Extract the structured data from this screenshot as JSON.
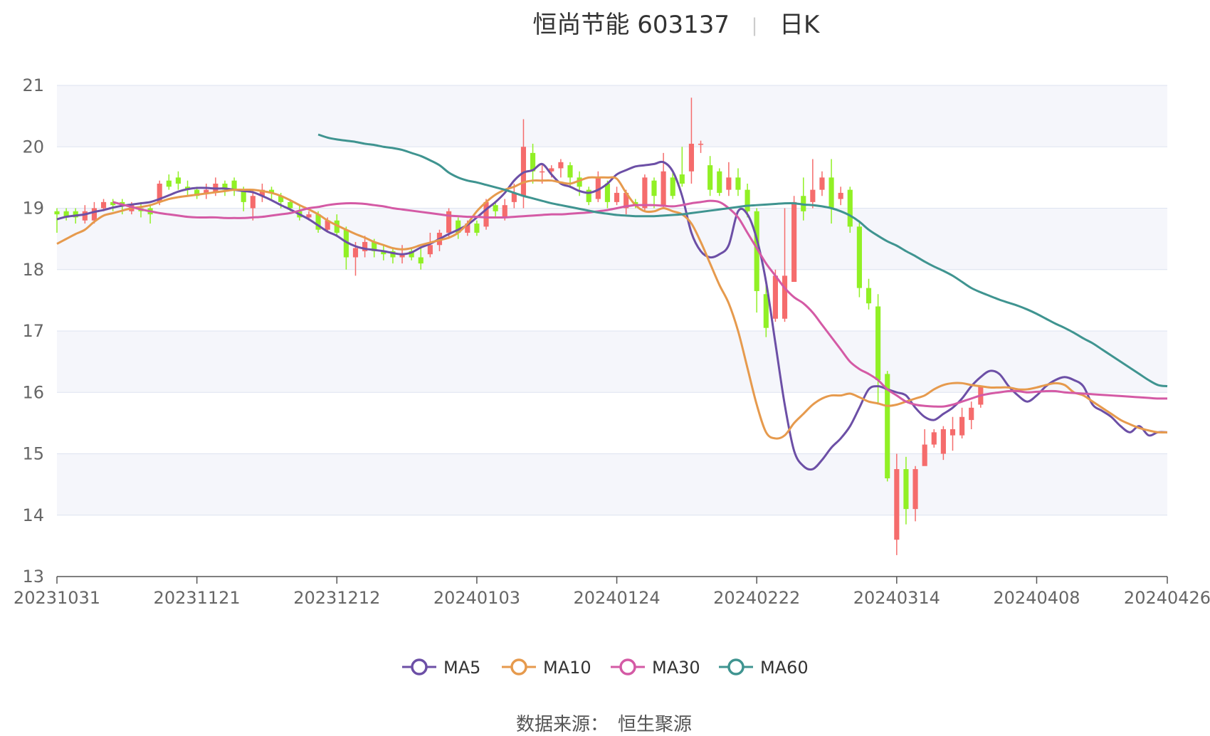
{
  "header": {
    "name_code": "恒尚节能 603137",
    "separator": "|",
    "period": "日K"
  },
  "source": {
    "label": "数据来源：",
    "value": "恒生聚源"
  },
  "colors": {
    "up": "#f56c6c",
    "down": "#91f025",
    "band": "#f5f6fb",
    "grid": "#dde3f0",
    "MA5": "#6c4fa6",
    "MA10": "#e69a4d",
    "MA30": "#d45aa5",
    "MA60": "#3f9490"
  },
  "chart_data": {
    "type": "candlestick",
    "title": "恒尚节能 603137 日K",
    "ylim": [
      13,
      21
    ],
    "yticks": [
      13,
      14,
      15,
      16,
      17,
      18,
      19,
      20,
      21
    ],
    "grid": true,
    "legend_position": "bottom-center",
    "categories": [
      "20231031",
      "20231101",
      "20231102",
      "20231103",
      "20231106",
      "20231107",
      "20231108",
      "20231109",
      "20231110",
      "20231113",
      "20231114",
      "20231115",
      "20231116",
      "20231117",
      "20231120",
      "20231121",
      "20231122",
      "20231123",
      "20231124",
      "20231127",
      "20231128",
      "20231129",
      "20231130",
      "20231201",
      "20231204",
      "20231205",
      "20231206",
      "20231207",
      "20231208",
      "20231211",
      "20231212",
      "20231213",
      "20231214",
      "20231215",
      "20231218",
      "20231219",
      "20231220",
      "20231221",
      "20231222",
      "20231225",
      "20231226",
      "20231227",
      "20231228",
      "20231229",
      "20240102",
      "20240103",
      "20240104",
      "20240105",
      "20240108",
      "20240109",
      "20240110",
      "20240111",
      "20240112",
      "20240115",
      "20240116",
      "20240117",
      "20240118",
      "20240119",
      "20240122",
      "20240123",
      "20240124",
      "20240125",
      "20240126",
      "20240129",
      "20240130",
      "20240131",
      "20240201",
      "20240202",
      "20240205",
      "20240206",
      "20240207",
      "20240208",
      "20240219",
      "20240220",
      "20240221",
      "20240222",
      "20240223",
      "20240226",
      "20240227",
      "20240228",
      "20240229",
      "20240301",
      "20240304",
      "20240305",
      "20240306",
      "20240307",
      "20240308",
      "20240311",
      "20240312",
      "20240313",
      "20240314",
      "20240315",
      "20240318",
      "20240319",
      "20240320",
      "20240321",
      "20240322",
      "20240325",
      "20240326",
      "20240327",
      "20240328",
      "20240329",
      "20240401",
      "20240402",
      "20240403",
      "20240408",
      "20240409",
      "20240410",
      "20240411",
      "20240412",
      "20240415",
      "20240416",
      "20240417",
      "20240418",
      "20240419",
      "20240422",
      "20240423",
      "20240424",
      "20240425",
      "20240426"
    ],
    "xtick_labels": [
      "20231031",
      "20231121",
      "20231212",
      "20240103",
      "20240124",
      "20240222",
      "20240314",
      "20240408",
      "20240426"
    ],
    "xtick_indices": [
      0,
      15,
      30,
      45,
      60,
      75,
      90,
      105,
      119
    ],
    "ohlc": [
      [
        18.95,
        18.9,
        18.6,
        19.0
      ],
      [
        18.95,
        18.85,
        18.8,
        19.0
      ],
      [
        18.95,
        18.85,
        18.75,
        19.0
      ],
      [
        18.8,
        18.95,
        18.75,
        19.05
      ],
      [
        18.8,
        19.0,
        18.75,
        19.1
      ],
      [
        19.0,
        19.1,
        18.95,
        19.15
      ],
      [
        19.1,
        19.05,
        18.95,
        19.15
      ],
      [
        19.1,
        19.05,
        18.9,
        19.15
      ],
      [
        18.95,
        19.05,
        18.9,
        19.1
      ],
      [
        19.0,
        18.95,
        18.85,
        19.1
      ],
      [
        19.0,
        18.9,
        18.75,
        19.05
      ],
      [
        19.1,
        19.4,
        19.05,
        19.45
      ],
      [
        19.45,
        19.35,
        19.3,
        19.55
      ],
      [
        19.5,
        19.4,
        19.3,
        19.6
      ],
      [
        19.35,
        19.3,
        19.2,
        19.45
      ],
      [
        19.3,
        19.2,
        19.15,
        19.35
      ],
      [
        19.25,
        19.3,
        19.15,
        19.4
      ],
      [
        19.25,
        19.4,
        19.2,
        19.5
      ],
      [
        19.4,
        19.3,
        19.2,
        19.45
      ],
      [
        19.45,
        19.3,
        19.2,
        19.5
      ],
      [
        19.3,
        19.1,
        18.95,
        19.35
      ],
      [
        19.0,
        19.2,
        18.8,
        19.3
      ],
      [
        19.2,
        19.3,
        19.1,
        19.4
      ],
      [
        19.3,
        19.25,
        19.15,
        19.35
      ],
      [
        19.2,
        19.1,
        19.0,
        19.25
      ],
      [
        19.1,
        19.0,
        18.95,
        19.15
      ],
      [
        18.95,
        18.85,
        18.8,
        19.05
      ],
      [
        18.85,
        18.9,
        18.8,
        18.95
      ],
      [
        18.9,
        18.65,
        18.6,
        18.95
      ],
      [
        18.65,
        18.8,
        18.6,
        18.85
      ],
      [
        18.8,
        18.6,
        18.55,
        18.9
      ],
      [
        18.65,
        18.2,
        18.0,
        18.7
      ],
      [
        18.2,
        18.35,
        17.9,
        18.45
      ],
      [
        18.3,
        18.45,
        18.2,
        18.55
      ],
      [
        18.45,
        18.3,
        18.2,
        18.5
      ],
      [
        18.3,
        18.25,
        18.15,
        18.4
      ],
      [
        18.3,
        18.2,
        18.1,
        18.35
      ],
      [
        18.2,
        18.25,
        18.1,
        18.4
      ],
      [
        18.3,
        18.2,
        18.15,
        18.35
      ],
      [
        18.2,
        18.1,
        18.0,
        18.35
      ],
      [
        18.25,
        18.4,
        18.2,
        18.6
      ],
      [
        18.4,
        18.6,
        18.3,
        18.65
      ],
      [
        18.6,
        18.95,
        18.5,
        19.0
      ],
      [
        18.8,
        18.6,
        18.5,
        18.85
      ],
      [
        18.6,
        18.75,
        18.55,
        18.8
      ],
      [
        18.75,
        18.6,
        18.55,
        18.8
      ],
      [
        18.7,
        19.1,
        18.65,
        19.15
      ],
      [
        19.05,
        18.95,
        18.85,
        19.1
      ],
      [
        18.85,
        19.05,
        18.8,
        19.15
      ],
      [
        19.1,
        19.25,
        19.0,
        19.4
      ],
      [
        19.2,
        20.0,
        19.0,
        20.45
      ],
      [
        19.9,
        19.6,
        19.4,
        20.05
      ],
      [
        19.6,
        19.6,
        19.4,
        19.7
      ],
      [
        19.6,
        19.65,
        19.5,
        19.7
      ],
      [
        19.65,
        19.75,
        19.5,
        19.8
      ],
      [
        19.7,
        19.5,
        19.35,
        19.75
      ],
      [
        19.5,
        19.35,
        19.2,
        19.6
      ],
      [
        19.3,
        19.1,
        19.05,
        19.35
      ],
      [
        19.15,
        19.5,
        19.1,
        19.6
      ],
      [
        19.4,
        19.1,
        19.0,
        19.45
      ],
      [
        19.1,
        19.25,
        19.05,
        19.35
      ],
      [
        19.0,
        19.25,
        18.9,
        19.3
      ],
      [
        19.1,
        19.05,
        19.0,
        19.15
      ],
      [
        19.0,
        19.5,
        18.95,
        19.55
      ],
      [
        19.45,
        19.2,
        19.0,
        19.5
      ],
      [
        19.05,
        19.6,
        19.0,
        19.9
      ],
      [
        19.5,
        19.2,
        19.15,
        19.6
      ],
      [
        19.55,
        19.4,
        19.35,
        20.0
      ],
      [
        19.6,
        20.05,
        19.4,
        20.8
      ],
      [
        20.05,
        20.05,
        19.9,
        20.1
      ],
      [
        19.7,
        19.3,
        19.2,
        19.85
      ],
      [
        19.6,
        19.25,
        19.2,
        19.65
      ],
      [
        19.3,
        19.5,
        19.2,
        19.75
      ],
      [
        19.5,
        19.3,
        19.2,
        19.65
      ],
      [
        19.3,
        18.95,
        18.85,
        19.4
      ],
      [
        18.95,
        17.65,
        17.3,
        19.0
      ],
      [
        17.6,
        17.05,
        16.9,
        17.75
      ],
      [
        17.2,
        17.9,
        17.15,
        18.0
      ],
      [
        17.2,
        17.9,
        17.15,
        19.0
      ],
      [
        17.8,
        19.1,
        17.8,
        19.2
      ],
      [
        19.2,
        18.95,
        18.8,
        19.5
      ],
      [
        19.1,
        19.3,
        19.0,
        19.8
      ],
      [
        19.3,
        19.5,
        19.2,
        19.6
      ],
      [
        19.5,
        19.0,
        18.75,
        19.8
      ],
      [
        19.15,
        19.25,
        19.05,
        19.35
      ],
      [
        19.3,
        18.7,
        18.6,
        19.35
      ],
      [
        18.7,
        17.7,
        17.55,
        18.8
      ],
      [
        17.7,
        17.45,
        17.35,
        17.85
      ],
      [
        17.4,
        16.2,
        15.8,
        17.6
      ],
      [
        16.3,
        14.6,
        14.55,
        16.35
      ],
      [
        13.6,
        14.75,
        13.35,
        15.0
      ],
      [
        14.75,
        14.1,
        13.85,
        14.95
      ],
      [
        14.1,
        14.75,
        13.9,
        14.8
      ],
      [
        14.8,
        15.15,
        14.9,
        15.4
      ],
      [
        15.15,
        15.35,
        15.1,
        15.4
      ],
      [
        15.0,
        15.4,
        14.9,
        15.45
      ],
      [
        15.3,
        15.4,
        15.05,
        15.6
      ],
      [
        15.3,
        15.6,
        15.25,
        15.75
      ],
      [
        15.55,
        15.75,
        15.4,
        15.85
      ],
      [
        15.8,
        16.1,
        15.75,
        16.1
      ]
    ],
    "ma_series": [
      {
        "name": "MA5",
        "values": [
          18.82,
          18.86,
          18.88,
          18.9,
          18.94,
          18.97,
          19.01,
          19.04,
          19.06,
          19.08,
          19.1,
          19.15,
          19.21,
          19.27,
          19.31,
          19.33,
          19.33,
          19.32,
          19.32,
          19.3,
          19.28,
          19.26,
          19.2,
          19.13,
          19.05,
          18.98,
          18.9,
          18.82,
          18.72,
          18.62,
          18.55,
          18.45,
          18.38,
          18.34,
          18.32,
          18.3,
          18.27,
          18.25,
          18.28,
          18.36,
          18.42,
          18.5,
          18.58,
          18.65,
          18.73,
          18.85,
          18.98,
          19.1,
          19.25,
          19.45,
          19.58,
          19.62,
          19.72,
          19.55,
          19.4,
          19.35,
          19.28,
          19.25,
          19.3,
          19.4,
          19.55,
          19.62,
          19.68,
          19.7,
          19.72,
          19.75,
          19.6,
          19.2,
          18.6,
          18.3,
          18.2,
          18.25,
          18.4,
          18.95,
          18.9,
          18.5,
          17.8,
          16.8,
          15.8,
          15.05,
          14.8,
          14.75,
          14.9,
          15.1,
          15.25,
          15.45,
          15.75,
          16.05,
          16.1,
          16.05,
          16.0,
          15.95,
          15.75,
          15.6,
          15.55,
          15.65,
          15.75,
          15.9,
          16.1,
          16.25,
          16.35,
          16.3,
          16.1,
          15.95,
          15.85,
          15.95,
          16.1,
          16.2,
          16.25,
          16.2,
          16.1,
          15.8,
          15.7,
          15.6,
          15.45,
          15.35,
          15.45,
          15.3,
          15.35,
          15.35
        ]
      },
      {
        "name": "MA10",
        "values": [
          18.42,
          18.5,
          18.58,
          18.65,
          18.78,
          18.88,
          18.92,
          18.96,
          19.0,
          19.02,
          19.05,
          19.1,
          19.15,
          19.18,
          19.2,
          19.22,
          19.24,
          19.26,
          19.28,
          19.3,
          19.3,
          19.3,
          19.28,
          19.25,
          19.2,
          19.13,
          19.05,
          18.98,
          18.9,
          18.8,
          18.72,
          18.65,
          18.58,
          18.52,
          18.45,
          18.4,
          18.35,
          18.33,
          18.35,
          18.4,
          18.44,
          18.48,
          18.52,
          18.6,
          18.75,
          18.95,
          19.1,
          19.22,
          19.3,
          19.35,
          19.42,
          19.45,
          19.45,
          19.45,
          19.42,
          19.4,
          19.45,
          19.5,
          19.5,
          19.5,
          19.48,
          19.25,
          19.05,
          18.95,
          18.95,
          19.0,
          18.95,
          18.9,
          18.75,
          18.45,
          18.1,
          17.75,
          17.45,
          17.0,
          16.4,
          15.8,
          15.35,
          15.25,
          15.3,
          15.5,
          15.65,
          15.8,
          15.9,
          15.95,
          15.95,
          15.98,
          15.92,
          15.85,
          15.82,
          15.78,
          15.8,
          15.85,
          15.9,
          15.95,
          16.05,
          16.12,
          16.15,
          16.15,
          16.12,
          16.1,
          16.08,
          16.08,
          16.08,
          16.05,
          16.05,
          16.08,
          16.12,
          16.15,
          16.12,
          16.0,
          15.95,
          15.85,
          15.75,
          15.65,
          15.55,
          15.48,
          15.42,
          15.38,
          15.35,
          15.35
        ]
      },
      {
        "name": "MA30",
        "values": [
          19.1,
          19.06,
          19.02,
          18.98,
          18.95,
          18.92,
          18.9,
          18.88,
          18.86,
          18.85,
          18.85,
          18.85,
          18.84,
          18.84,
          18.84,
          18.85,
          18.86,
          18.88,
          18.9,
          18.92,
          18.96,
          19.0,
          19.02,
          19.05,
          19.07,
          19.08,
          19.08,
          19.07,
          19.05,
          19.03,
          19.0,
          18.98,
          18.96,
          18.94,
          18.92,
          18.9,
          18.88,
          18.87,
          18.86,
          18.86,
          18.85,
          18.85,
          18.85,
          18.86,
          18.87,
          18.88,
          18.89,
          18.9,
          18.9,
          18.91,
          18.92,
          18.93,
          18.95,
          18.97,
          19.0,
          19.03,
          19.05,
          19.05,
          19.05,
          19.04,
          19.03,
          19.05,
          19.08,
          19.1,
          19.12,
          19.1,
          19.0,
          18.85,
          18.6,
          18.35,
          18.1,
          17.9,
          17.7,
          17.55,
          17.45,
          17.3,
          17.1,
          16.9,
          16.7,
          16.5,
          16.38,
          16.3,
          16.2,
          16.05,
          15.95,
          15.85,
          15.8,
          15.78,
          15.77,
          15.77,
          15.8,
          15.85,
          15.9,
          15.95,
          15.98,
          16.0,
          16.02,
          16.02,
          16.0,
          16.01,
          16.02,
          16.02,
          16.0,
          15.99,
          15.98,
          15.97,
          15.96,
          15.95,
          15.94,
          15.93,
          15.92,
          15.91,
          15.9,
          15.9
        ]
      },
      {
        "name": "MA60",
        "values": [
          20.2,
          20.15,
          20.12,
          20.1,
          20.08,
          20.05,
          20.03,
          20.0,
          19.98,
          19.95,
          19.9,
          19.85,
          19.78,
          19.7,
          19.58,
          19.5,
          19.45,
          19.42,
          19.38,
          19.34,
          19.3,
          19.25,
          19.2,
          19.16,
          19.12,
          19.08,
          19.05,
          19.02,
          18.99,
          18.96,
          18.93,
          18.91,
          18.89,
          18.88,
          18.87,
          18.87,
          18.87,
          18.88,
          18.89,
          18.9,
          18.92,
          18.94,
          18.96,
          18.98,
          19.0,
          19.02,
          19.04,
          19.05,
          19.06,
          19.07,
          19.08,
          19.08,
          19.06,
          19.05,
          19.03,
          19.0,
          18.95,
          18.88,
          18.78,
          18.65,
          18.55,
          18.46,
          18.39,
          18.3,
          18.22,
          18.13,
          18.05,
          17.98,
          17.9,
          17.8,
          17.7,
          17.63,
          17.57,
          17.51,
          17.46,
          17.41,
          17.35,
          17.28,
          17.2,
          17.12,
          17.05,
          16.97,
          16.88,
          16.8,
          16.7,
          16.6,
          16.5,
          16.4,
          16.3,
          16.2,
          16.12,
          16.1
        ]
      }
    ]
  }
}
